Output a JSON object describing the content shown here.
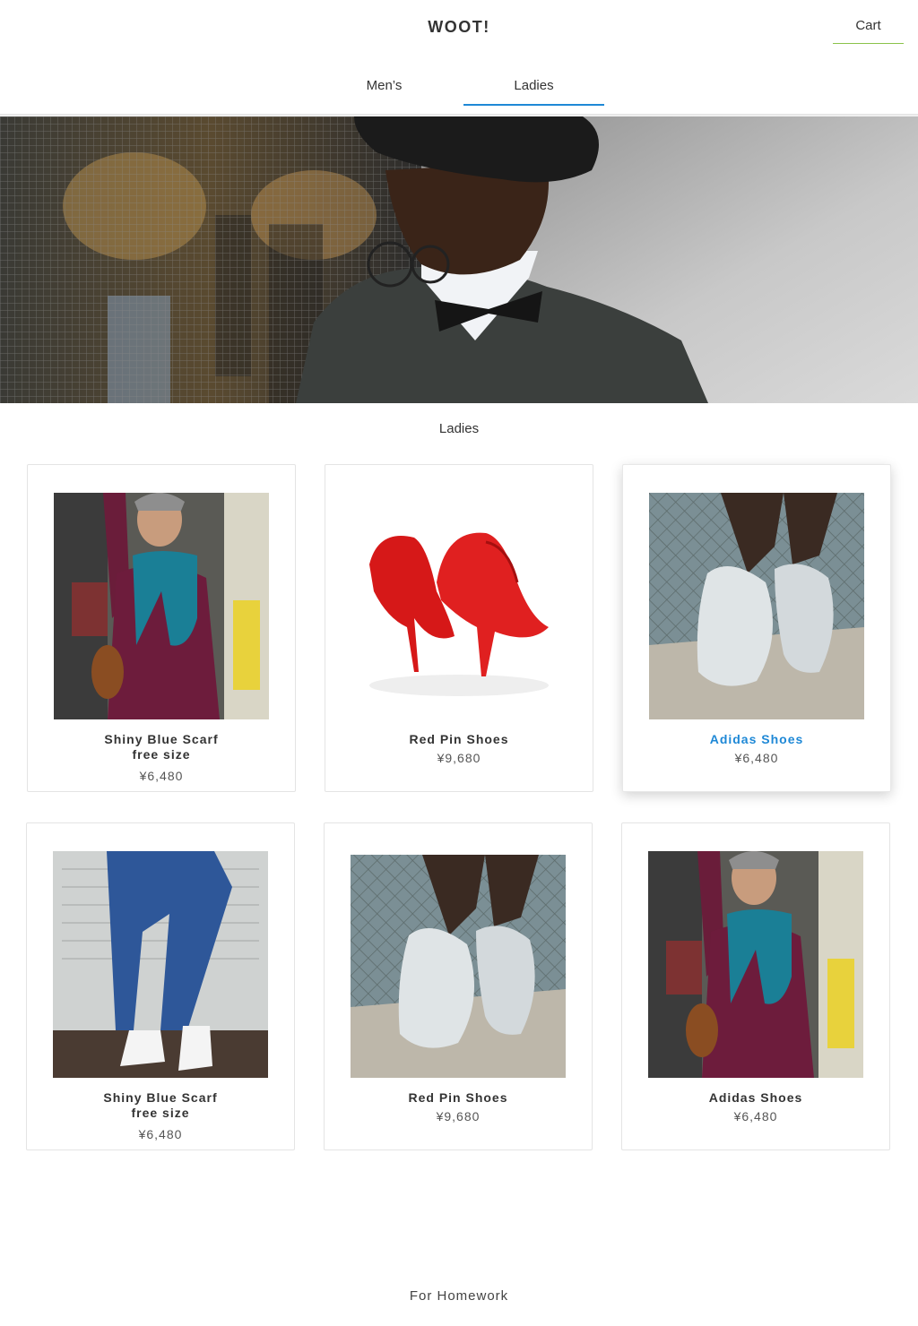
{
  "header": {
    "brand": "WOOT!",
    "cart_label": "Cart"
  },
  "tabs": [
    {
      "label": "Men’s",
      "active": false
    },
    {
      "label": "Ladies",
      "active": true
    }
  ],
  "section_title": "Ladies",
  "products": [
    {
      "name": "Shiny Blue Scarf",
      "subtitle": "free size",
      "price": "¥6,480",
      "image": "woman-scarf-photo"
    },
    {
      "name": "Red Pin Shoes",
      "subtitle": "",
      "price": "¥9,680",
      "image": "red-heels-photo"
    },
    {
      "name": "Adidas Shoes",
      "subtitle": "",
      "price": "¥6,480",
      "image": "sneakers-photo",
      "hovered": true
    },
    {
      "name": "Shiny Blue Scarf",
      "subtitle": "free size",
      "price": "¥6,480",
      "image": "jeans-converse-photo"
    },
    {
      "name": "Red Pin Shoes",
      "subtitle": "",
      "price": "¥9,680",
      "image": "sneakers-photo"
    },
    {
      "name": "Adidas Shoes",
      "subtitle": "",
      "price": "¥6,480",
      "image": "woman-scarf-photo"
    }
  ],
  "colors": {
    "accent_blue": "#1e88d6",
    "cart_underline": "#8bc34a"
  },
  "footer": {
    "text": "For Homework"
  }
}
